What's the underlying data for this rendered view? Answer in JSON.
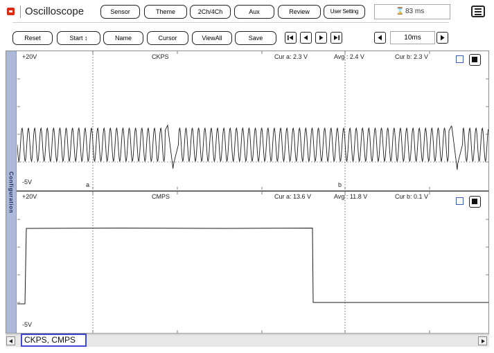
{
  "app": {
    "title": "Oscilloscope"
  },
  "toolbar": {
    "top_buttons": [
      "Sensor",
      "Theme",
      "2Ch/4Ch",
      "Aux",
      "Review",
      "User Setting"
    ],
    "refresh": "83 ms",
    "second_buttons": [
      "Reset",
      "Start ↕",
      "Name",
      "Cursor",
      "ViewAll",
      "Save"
    ],
    "timebase": "10ms"
  },
  "config_tab": "Configuration",
  "channels": [
    {
      "id": "ckps",
      "name": "CKPS",
      "ymax_label": "+20V",
      "ymin_label": "-5V",
      "cur_a": "Cur a: 2.3 V",
      "avg": "Avg : 2.4 V",
      "cur_b": "Cur b: 2.3 V",
      "cursor_a_label": "a",
      "cursor_b_label": "b"
    },
    {
      "id": "cmps",
      "name": "CMPS",
      "ymax_label": "+20V",
      "ymin_label": "-5V",
      "cur_a": "Cur a: 13.6 V",
      "avg": "Avg : 11.8 V",
      "cur_b": "Cur b: 0.1 V"
    }
  ],
  "footer": {
    "channel_tab": "CKPS, CMPS"
  },
  "colors": {
    "accent_red": "#d92b16",
    "config_tab": "#aeb9d9",
    "tab_border": "#3f4ad1",
    "checkbox_border": "#3b5bb5"
  },
  "icons": [
    "oscilloscope-icon",
    "hourglass-icon",
    "menu-icon",
    "skip-first-icon",
    "step-back-icon",
    "step-forward-icon",
    "skip-last-icon",
    "time-decrease-icon",
    "time-increase-icon",
    "checkbox-icon",
    "stop-icon",
    "scroll-left-icon",
    "scroll-right-icon"
  ]
}
